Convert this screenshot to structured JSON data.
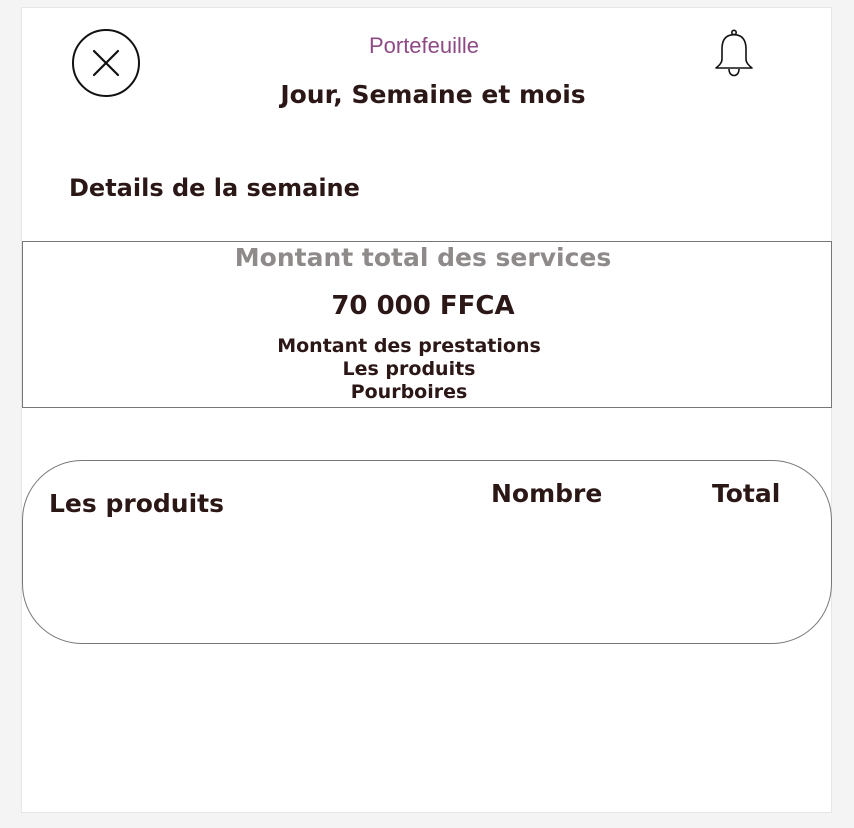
{
  "header": {
    "app_label": "Portefeuille",
    "title": "Jour, Semaine et mois",
    "close_icon": "close-circle-icon",
    "notification_icon": "bell-icon"
  },
  "section": {
    "title": "Details de la semaine"
  },
  "summary": {
    "heading": "Montant total des services",
    "amount": "70 000 FFCA",
    "lines": [
      "Montant des prestations",
      "Les produits",
      "Pourboires"
    ]
  },
  "products_table": {
    "columns": [
      "Les produits",
      "Nombre",
      "Total"
    ],
    "rows": []
  },
  "colors": {
    "accent": "#8e4a85",
    "text": "#2b1716",
    "muted": "#8f8a8a"
  }
}
